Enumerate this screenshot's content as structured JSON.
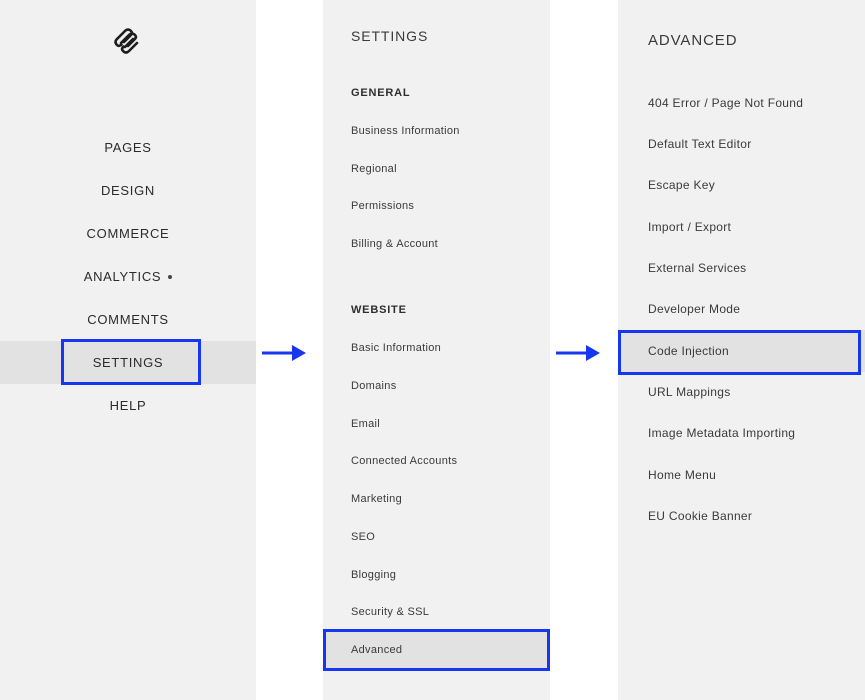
{
  "main_nav": {
    "items": [
      {
        "label": "PAGES"
      },
      {
        "label": "DESIGN"
      },
      {
        "label": "COMMERCE"
      },
      {
        "label": "ANALYTICS"
      },
      {
        "label": "COMMENTS"
      },
      {
        "label": "SETTINGS"
      },
      {
        "label": "HELP"
      }
    ]
  },
  "settings_panel": {
    "title": "SETTINGS",
    "general": {
      "title": "GENERAL",
      "items": [
        {
          "label": "Business Information"
        },
        {
          "label": "Regional"
        },
        {
          "label": "Permissions"
        },
        {
          "label": "Billing & Account"
        }
      ]
    },
    "website": {
      "title": "WEBSITE",
      "items": [
        {
          "label": "Basic Information"
        },
        {
          "label": "Domains"
        },
        {
          "label": "Email"
        },
        {
          "label": "Connected Accounts"
        },
        {
          "label": "Marketing"
        },
        {
          "label": "SEO"
        },
        {
          "label": "Blogging"
        },
        {
          "label": "Security & SSL"
        },
        {
          "label": "Advanced"
        }
      ]
    }
  },
  "advanced_panel": {
    "title": "ADVANCED",
    "items": [
      {
        "label": "404 Error / Page Not Found"
      },
      {
        "label": "Default Text Editor"
      },
      {
        "label": "Escape Key"
      },
      {
        "label": "Import / Export"
      },
      {
        "label": "External Services"
      },
      {
        "label": "Developer Mode"
      },
      {
        "label": "Code Injection"
      },
      {
        "label": "URL Mappings"
      },
      {
        "label": "Image Metadata Importing"
      },
      {
        "label": "Home Menu"
      },
      {
        "label": "EU Cookie Banner"
      }
    ]
  },
  "colors": {
    "highlight": "#1636f0",
    "panel_bg": "#f1f1f1",
    "active_bg": "#e2e2e2"
  },
  "icons": [
    "squarespace-logo-icon",
    "arrow-right-icon"
  ]
}
